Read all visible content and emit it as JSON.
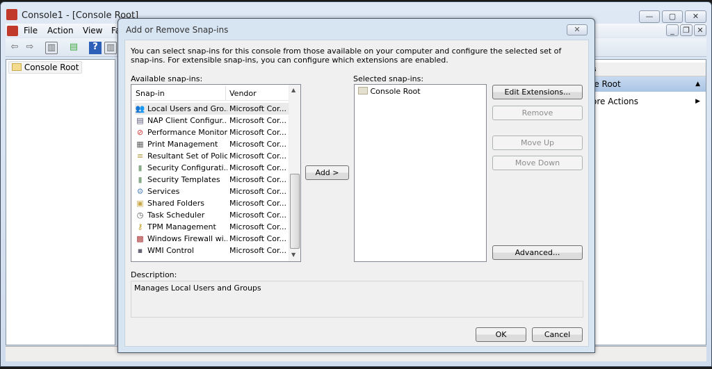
{
  "window": {
    "title": "Console1 - [Console Root]",
    "minimize": "—",
    "maximize": "▢",
    "close": "✕"
  },
  "menu": {
    "items": [
      "File",
      "Action",
      "View",
      "Fa"
    ],
    "child_min": "_",
    "child_restore": "❐",
    "child_close": "✕"
  },
  "tree": {
    "root": "Console Root"
  },
  "actions": {
    "header": "s",
    "section": "le Root",
    "more": "ore Actions"
  },
  "dialog": {
    "title": "Add or Remove Snap-ins",
    "close": "✕",
    "intro": "You can select snap-ins for this console from those available on your computer and configure the selected set of snap-ins. For extensible snap-ins, you can configure which extensions are enabled.",
    "available_label": "Available snap-ins:",
    "columns": [
      "Snap-in",
      "Vendor"
    ],
    "snapins": [
      {
        "name": "Local Users and Gro...",
        "vendor": "Microsoft Cor...",
        "icon": "users-icon"
      },
      {
        "name": "NAP Client Configur...",
        "vendor": "Microsoft Cor...",
        "icon": "nap-icon"
      },
      {
        "name": "Performance Monitor",
        "vendor": "Microsoft Cor...",
        "icon": "perfmon-icon"
      },
      {
        "name": "Print Management",
        "vendor": "Microsoft Cor...",
        "icon": "printer-icon"
      },
      {
        "name": "Resultant Set of Policy",
        "vendor": "Microsoft Cor...",
        "icon": "scroll-icon"
      },
      {
        "name": "Security Configurati...",
        "vendor": "Microsoft Cor...",
        "icon": "security-lock-icon"
      },
      {
        "name": "Security Templates",
        "vendor": "Microsoft Cor...",
        "icon": "security-lock-icon"
      },
      {
        "name": "Services",
        "vendor": "Microsoft Cor...",
        "icon": "gear-icon"
      },
      {
        "name": "Shared Folders",
        "vendor": "Microsoft Cor...",
        "icon": "shared-folder-icon"
      },
      {
        "name": "Task Scheduler",
        "vendor": "Microsoft Cor...",
        "icon": "clock-icon"
      },
      {
        "name": "TPM Management",
        "vendor": "Microsoft Cor...",
        "icon": "key-icon"
      },
      {
        "name": "Windows Firewall wi...",
        "vendor": "Microsoft Cor...",
        "icon": "firewall-icon"
      },
      {
        "name": "WMI Control",
        "vendor": "Microsoft Cor...",
        "icon": "wmi-icon"
      }
    ],
    "add": "Add >",
    "selected_label": "Selected snap-ins:",
    "selected": [
      "Console Root"
    ],
    "buttons": {
      "edit_ext": "Edit Extensions...",
      "remove": "Remove",
      "move_up": "Move Up",
      "move_down": "Move Down",
      "advanced": "Advanced..."
    },
    "description_label": "Description:",
    "description": "Manages Local Users and Groups",
    "ok": "OK",
    "cancel": "Cancel"
  }
}
